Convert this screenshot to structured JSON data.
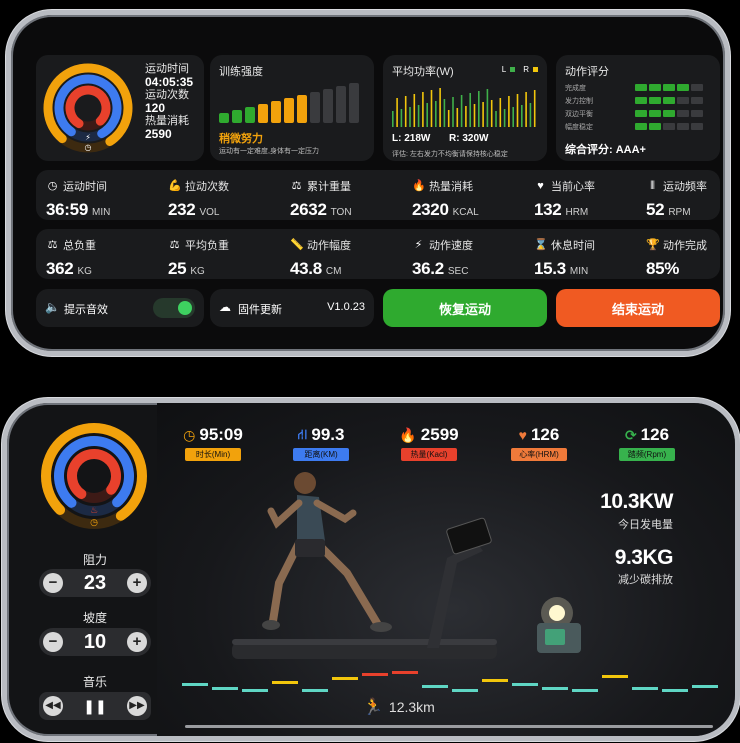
{
  "panel1": {
    "ring_card": {
      "items": [
        {
          "label": "运动时间",
          "value": "04:05:35"
        },
        {
          "label": "运动次数",
          "value": "120"
        },
        {
          "label": "热量消耗",
          "value": "2590"
        }
      ]
    },
    "intensity": {
      "title": "训练强度",
      "level": "稍微努力",
      "desc": "运动有一定难度,身体有一定压力",
      "active_bars": 7,
      "total_bars": 11
    },
    "power": {
      "title": "平均功率(W)",
      "legend_l": "L",
      "legend_r": "R",
      "left": "L: 218W",
      "right": "R: 320W",
      "note": "评估:  左右发力不均衡请保持核心稳定"
    },
    "rating": {
      "title": "动作评分",
      "items": [
        {
          "label": "完成度",
          "filled": 4
        },
        {
          "label": "发力控制",
          "filled": 3
        },
        {
          "label": "双边平衡",
          "filled": 3
        },
        {
          "label": "幅度稳定",
          "filled": 2
        }
      ],
      "total": "综合评分:  AAA+"
    },
    "stats_row1": [
      {
        "label": "运动时间",
        "value": "36:59",
        "unit": "MIN",
        "icon": "clock-icon"
      },
      {
        "label": "拉动次数",
        "value": "232",
        "unit": "VOL",
        "icon": "arm-icon"
      },
      {
        "label": "累计重量",
        "value": "2632",
        "unit": "TON",
        "icon": "weight-icon"
      },
      {
        "label": "热量消耗",
        "value": "2320",
        "unit": "KCAL",
        "icon": "flame-icon"
      },
      {
        "label": "当前心率",
        "value": "132",
        "unit": "HRM",
        "icon": "heart-icon"
      },
      {
        "label": "运动频率",
        "value": "52",
        "unit": "RPM",
        "icon": "frequency-icon"
      }
    ],
    "stats_row2": [
      {
        "label": "总负重",
        "value": "362",
        "unit": "KG",
        "icon": "scale-icon"
      },
      {
        "label": "平均负重",
        "value": "25",
        "unit": "KG",
        "icon": "scale-icon"
      },
      {
        "label": "动作幅度",
        "value": "43.8",
        "unit": "CM",
        "icon": "ruler-icon"
      },
      {
        "label": "动作速度",
        "value": "36.2",
        "unit": "SEC",
        "icon": "bolt-icon"
      },
      {
        "label": "休息时间",
        "value": "15.3",
        "unit": "MIN",
        "icon": "hourglass-icon"
      },
      {
        "label": "动作完成",
        "value": "85%",
        "unit": "",
        "icon": "trophy-icon"
      }
    ],
    "sound": {
      "label": "提示音效",
      "on": true
    },
    "firmware": {
      "label": "固件更新",
      "version": "V1.0.23"
    },
    "resume": "恢复运动",
    "end": "结束运动",
    "colors": {
      "green": "#2faa2f",
      "orange": "#f05a22",
      "yellow": "#f2a20c",
      "red": "#e8412c"
    }
  },
  "panel2": {
    "top_stats": [
      {
        "value": "95:09",
        "tag": "时长(Min)",
        "color": "#f2a20c",
        "icon": "clock-icon"
      },
      {
        "value": "99.3",
        "tag": "距离(KM)",
        "color": "#3d7bf0",
        "icon": "road-icon"
      },
      {
        "value": "2599",
        "tag": "热量(Kacl)",
        "color": "#e8412c",
        "icon": "flame-icon"
      },
      {
        "value": "126",
        "tag": "心率(HRM)",
        "color": "#f07a3a",
        "icon": "heart-icon"
      },
      {
        "value": "126",
        "tag": "踏频(Rpm)",
        "color": "#37b24d",
        "icon": "cadence-icon"
      }
    ],
    "energy": {
      "value": "10.3KW",
      "label": "今日发电量"
    },
    "carbon": {
      "value": "9.3KG",
      "label": "减少碳排放"
    },
    "resistance": {
      "label": "阻力",
      "value": "23"
    },
    "slope": {
      "label": "坡度",
      "value": "10"
    },
    "music": {
      "label": "音乐"
    },
    "distance": "12.3km"
  }
}
